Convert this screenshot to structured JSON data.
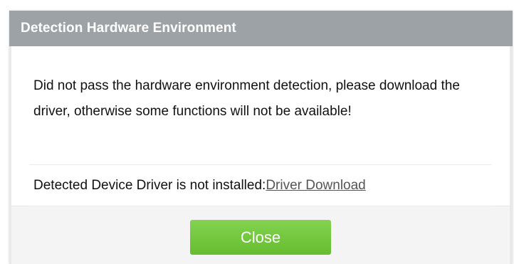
{
  "dialog": {
    "title": "Detection Hardware Environment",
    "message": "Did not pass the hardware environment detection, please download the driver, otherwise some functions will not be available!",
    "driver_status_text": "Detected Device Driver is not installed:",
    "driver_download_link": "Driver Download",
    "close_label": "Close"
  },
  "colors": {
    "title_bar": "#9da2a6",
    "close_button": "#72c63d",
    "link": "#555555"
  }
}
